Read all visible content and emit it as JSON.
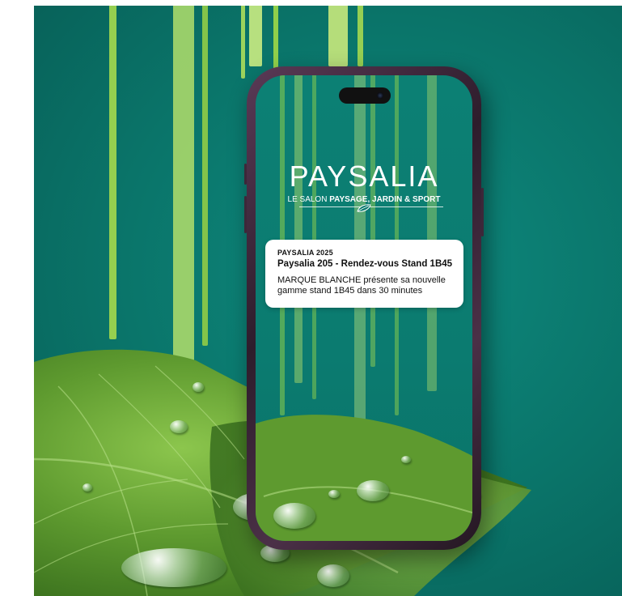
{
  "brand": {
    "title": "PAYSALIA",
    "subtitle_prefix": "LE SALON ",
    "subtitle_bold": "PAYSAGE, JARDIN & SPORT"
  },
  "notification": {
    "app": "PAYSALIA 2025",
    "title": "Paysalia 205 - Rendez-vous Stand 1B45",
    "body": "MARQUE BLANCHE présente sa nouvelle gamme stand 1B45 dans 30 minutes"
  },
  "colors": {
    "background_teal": "#0a7469",
    "stripe_green": "#8fcf4a",
    "phone_frame": "#3d2739",
    "leaf_green": "#5e9a2f"
  },
  "icons": {
    "logo_leaf": "leaf-icon",
    "camera": "camera-icon"
  }
}
